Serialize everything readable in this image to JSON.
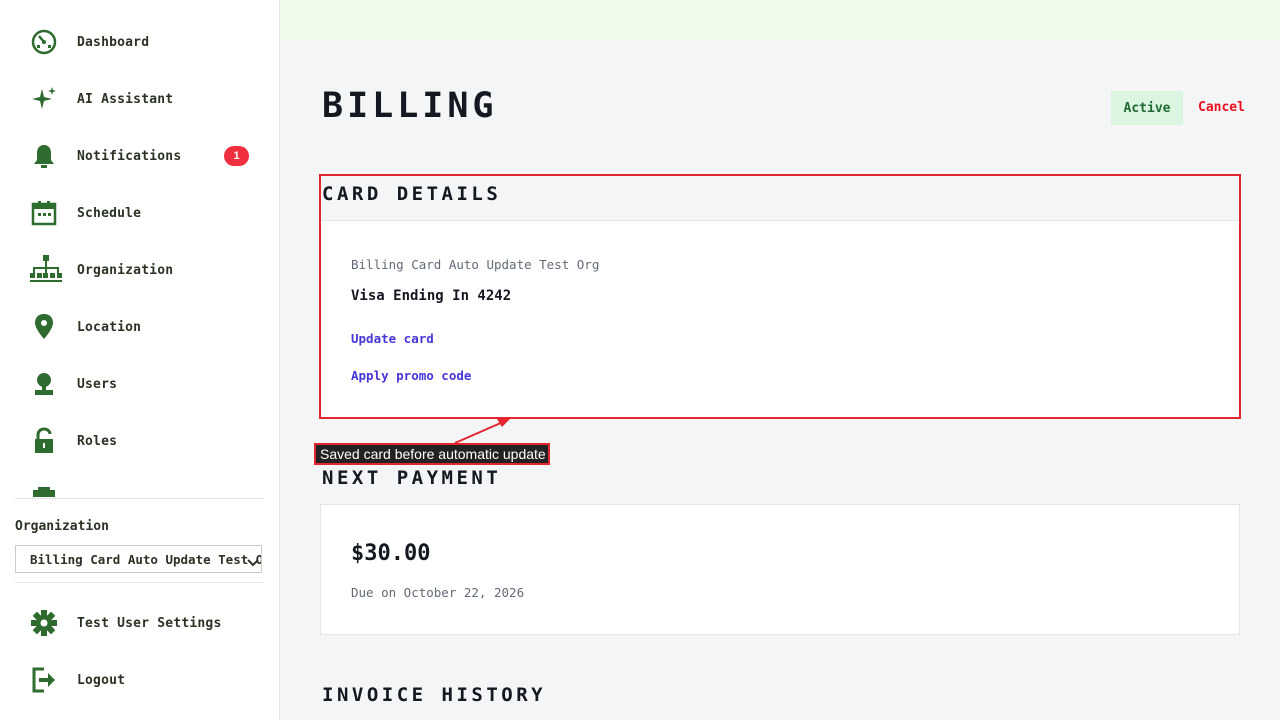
{
  "sidebar": {
    "nav_items": [
      {
        "label": "Dashboard",
        "icon": "dashboard-icon"
      },
      {
        "label": "AI Assistant",
        "icon": "sparkle-icon"
      },
      {
        "label": "Notifications",
        "icon": "bell-icon",
        "badge": "1"
      },
      {
        "label": "Schedule",
        "icon": "calendar-icon"
      },
      {
        "label": "Organization",
        "icon": "org-chart-icon"
      },
      {
        "label": "Location",
        "icon": "location-pin-icon"
      },
      {
        "label": "Users",
        "icon": "user-icon"
      },
      {
        "label": "Roles",
        "icon": "lock-icon"
      }
    ],
    "organization_label": "Organization",
    "organization_selected": "Billing Card Auto Update Test Org",
    "settings_label": "Test User Settings",
    "logout_label": "Logout"
  },
  "header": {
    "title": "Billing",
    "status": "Active",
    "cancel_label": "Cancel"
  },
  "card_details": {
    "heading": "Card Details",
    "org_name": "Billing Card Auto Update Test Org",
    "card_description": "Visa Ending In 4242",
    "update_card_label": "Update card",
    "promo_label": "Apply promo code"
  },
  "annotation": {
    "text": "Saved card before automatic update"
  },
  "next_payment": {
    "heading": "Next Payment",
    "amount": "$30.00",
    "due": "Due on October 22, 2026"
  },
  "invoice_history": {
    "heading": "Invoice History"
  },
  "colors": {
    "sidebar_icon": "#2e6b2e",
    "accent_link": "#4636d8",
    "danger": "#e8101e",
    "active_bg": "#dcf5e0",
    "annotation_border": "#e3252e"
  }
}
